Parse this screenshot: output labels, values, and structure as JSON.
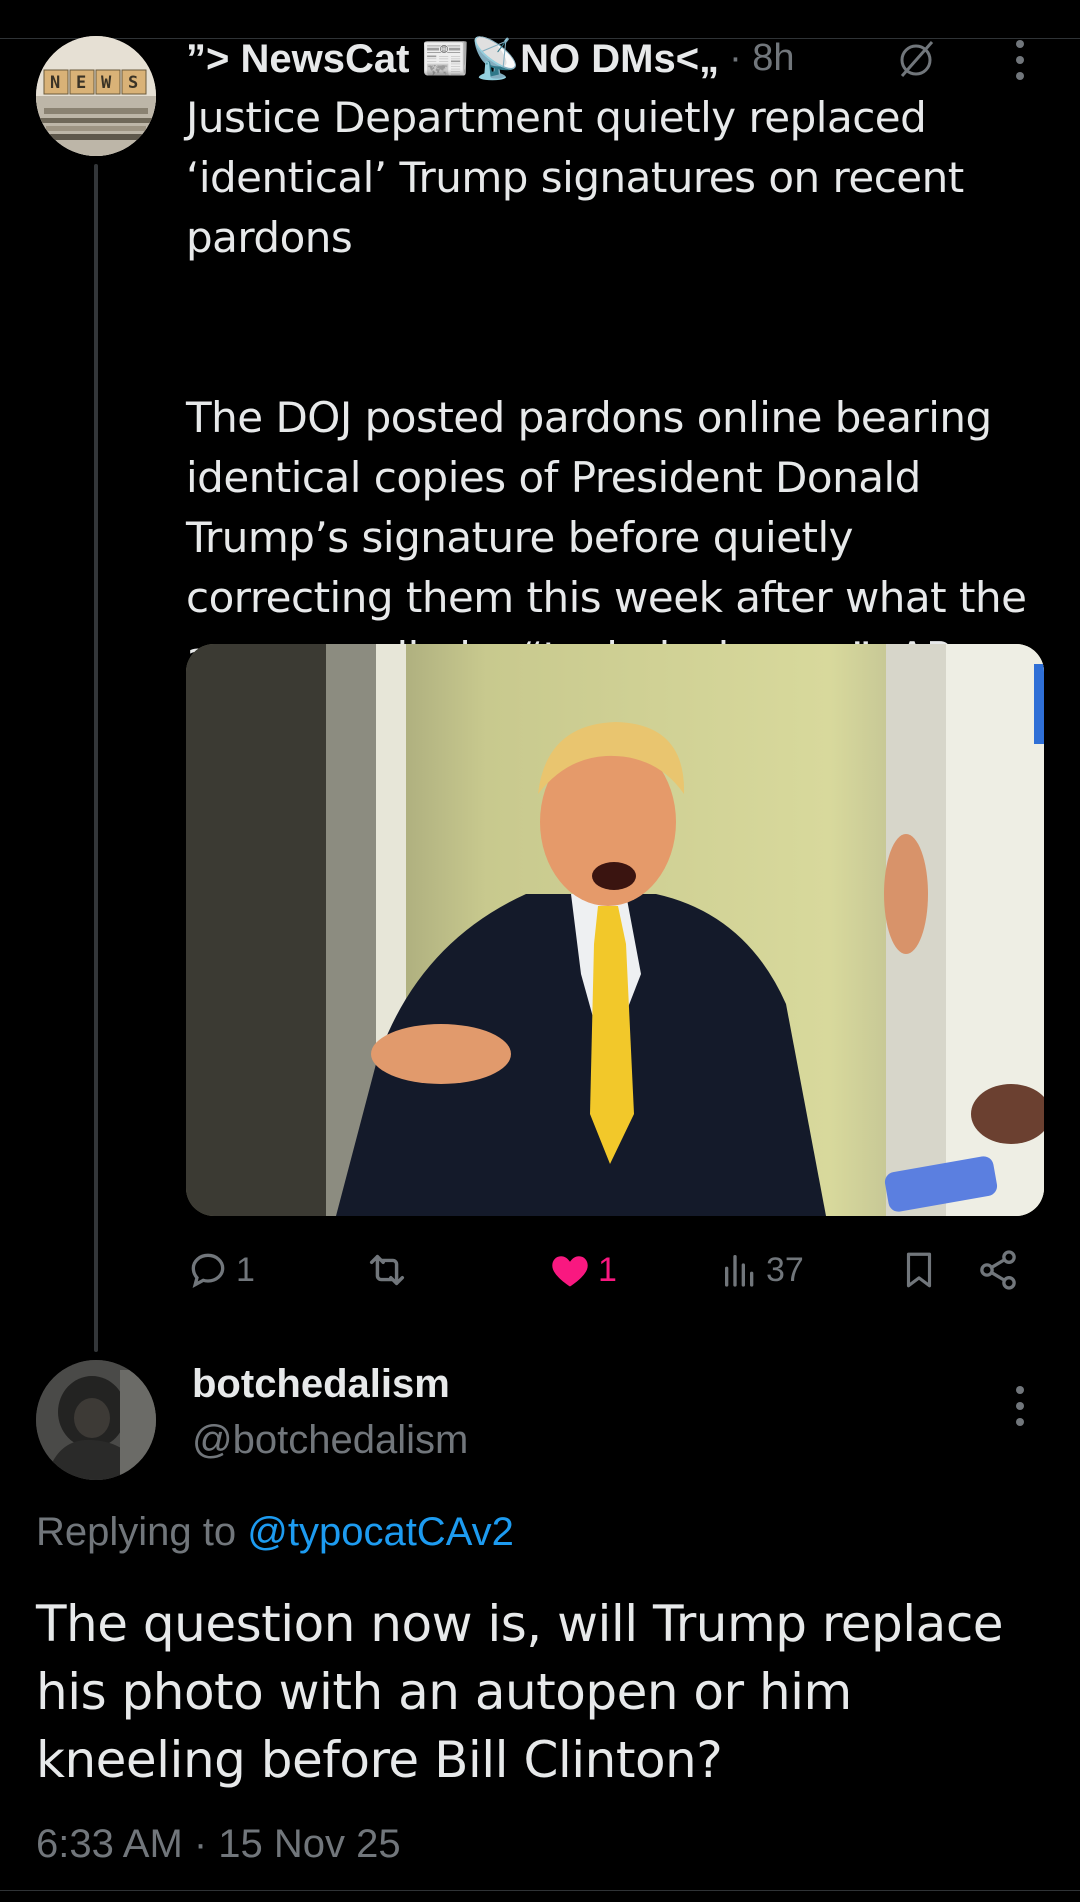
{
  "parent_tweet": {
    "display_name": "”> NewsCat 📰📡NO DMs<„",
    "time": "· 8h",
    "avatar_label": "NEWS",
    "text_title": "Justice Department quietly replaced ‘identical’ Trump signatures on recent pardons",
    "text_body": "The DOJ posted pardons online bearing identical copies of President Donald Trump’s signature before quietly correcting them this week after what the agency called a “technical error.” -AP",
    "actions": {
      "replies": "1",
      "reposts": "",
      "likes": "1",
      "views": "37"
    },
    "icons": [
      "mute-icon",
      "more-icon",
      "reply-icon",
      "repost-icon",
      "heart-icon",
      "views-icon",
      "bookmark-icon",
      "share-icon"
    ]
  },
  "reply": {
    "display_name": "botchedalism",
    "handle": "@botchedalism",
    "replying_prefix": "Replying to ",
    "replying_mention": "@typocatCAv2",
    "text": "The question now is, will Trump replace his photo with an autopen or him kneeling before Bill Clinton?",
    "timestamp": "6:33 AM · 15 Nov 25"
  },
  "colors": {
    "background": "#000000",
    "text": "#e7e9ea",
    "secondary": "#71767b",
    "like": "#f91880",
    "link": "#1d9bf0"
  }
}
